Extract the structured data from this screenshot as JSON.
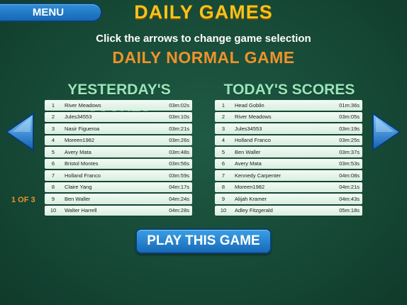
{
  "header": {
    "menu_label": "MENU",
    "title": "DAILY GAMES",
    "instruction": "Click the arrows to change game selection",
    "game_name": "DAILY NORMAL GAME"
  },
  "yesterday": {
    "title": "YESTERDAY'S SCORES",
    "rows": [
      {
        "rank": "1",
        "name": "River Meadows",
        "time": "03m:02s"
      },
      {
        "rank": "2",
        "name": "Jules34553",
        "time": "03m:10s"
      },
      {
        "rank": "3",
        "name": "Nasir Figueroa",
        "time": "03m:21s"
      },
      {
        "rank": "4",
        "name": "Moreen1982",
        "time": "03m:26s"
      },
      {
        "rank": "5",
        "name": "Avery Mata",
        "time": "03m:48s"
      },
      {
        "rank": "6",
        "name": "Bristol Montes",
        "time": "03m:56s"
      },
      {
        "rank": "7",
        "name": "Holland Franco",
        "time": "03m:59s"
      },
      {
        "rank": "8",
        "name": "Claire Yang",
        "time": "04m:17s"
      },
      {
        "rank": "9",
        "name": "Ben Waller",
        "time": "04m:24s"
      },
      {
        "rank": "10",
        "name": "Walter Harrell",
        "time": "04m:28s"
      }
    ]
  },
  "today": {
    "title": "TODAY'S SCORES",
    "rows": [
      {
        "rank": "1",
        "name": "Head Goblin",
        "time": "01m:36s"
      },
      {
        "rank": "2",
        "name": "River Meadows",
        "time": "03m:05s"
      },
      {
        "rank": "3",
        "name": "Jules34553",
        "time": "03m:19s"
      },
      {
        "rank": "4",
        "name": "Holland Franco",
        "time": "03m:25s"
      },
      {
        "rank": "5",
        "name": "Ben Waller",
        "time": "03m:37s"
      },
      {
        "rank": "6",
        "name": "Avery Mata",
        "time": "03m:53s"
      },
      {
        "rank": "7",
        "name": "Kennedy Carpenter",
        "time": "04m:08s"
      },
      {
        "rank": "8",
        "name": "Moreen1982",
        "time": "04m:21s"
      },
      {
        "rank": "9",
        "name": "Alijah Kramer",
        "time": "04m:43s"
      },
      {
        "rank": "10",
        "name": "Adley Fitzgerald",
        "time": "05m:18s"
      }
    ]
  },
  "pagination": {
    "label": "1 OF 3"
  },
  "play_button": {
    "label": "PLAY THIS GAME"
  },
  "colors": {
    "title": "#f7c21a",
    "game_name": "#f0922a",
    "board_title": "#9be6bb",
    "button_blue": "#1f7dcc"
  },
  "icons": {
    "prev": "left-arrow-icon",
    "next": "right-arrow-icon"
  }
}
